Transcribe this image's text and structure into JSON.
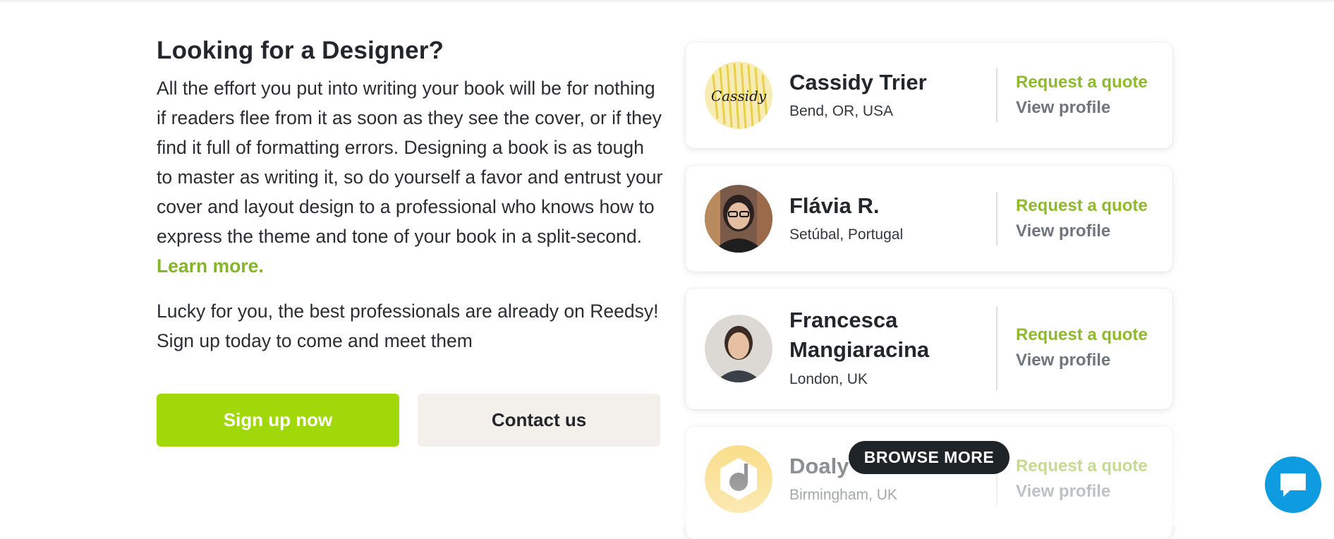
{
  "intro": {
    "heading": "Looking for a Designer?",
    "paragraph1": "All the effort you put into writing your book will be for nothing if readers flee from it as soon as they see the cover, or if they find it full of formatting errors. Designing a book is as tough to master as writing it, so do yourself a favor and entrust your cover and layout design to a professional who knows how to express the theme and tone of your book in a split-second.",
    "learn_more": "Learn more.",
    "paragraph2": "Lucky for you, the best professionals are already on Reedsy! Sign up today to come and meet them",
    "signup_label": "Sign up now",
    "contact_label": "Contact us"
  },
  "designers": [
    {
      "name": "Cassidy Trier",
      "location": "Bend, OR, USA",
      "quote_label": "Request a quote",
      "profile_label": "View profile",
      "avatar_text": "Cassidy"
    },
    {
      "name": "Flávia R.",
      "location": "Setúbal, Portugal",
      "quote_label": "Request a quote",
      "profile_label": "View profile"
    },
    {
      "name": "Francesca Mangiaracina",
      "location": "London, UK",
      "quote_label": "Request a quote",
      "profile_label": "View profile"
    },
    {
      "name": "Doaly",
      "location": "Birmingham, UK",
      "quote_label": "Request a quote",
      "profile_label": "View profile"
    }
  ],
  "browse_more_label": "BROWSE MORE",
  "colors": {
    "brand_green": "#a0d80a",
    "link_green": "#8fba2c",
    "chat_blue": "#0f9be0",
    "dark": "#1e2428"
  },
  "icons": {
    "chat": "chat-bubble-icon"
  }
}
